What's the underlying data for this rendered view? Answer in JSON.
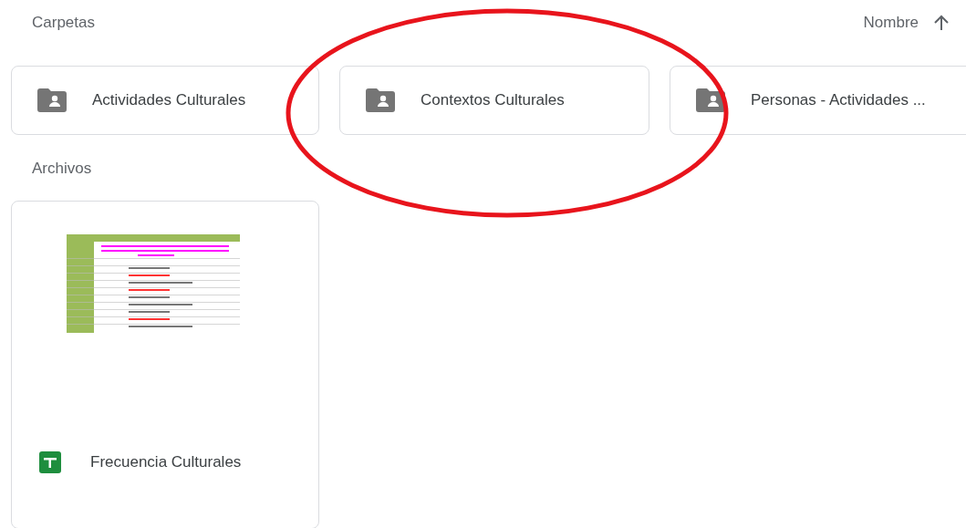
{
  "folders_section": {
    "title": "Carpetas",
    "sort": {
      "label": "Nombre",
      "ascending": true
    }
  },
  "folders": [
    {
      "name": "Actividades Culturales"
    },
    {
      "name": "Contextos Culturales"
    },
    {
      "name": "Personas - Actividades ..."
    }
  ],
  "files_section": {
    "title": "Archivos"
  },
  "files": [
    {
      "name": "Frecuencia Culturales",
      "kind": "spreadsheet"
    }
  ],
  "annotation": {
    "kind": "ellipse",
    "color": "#e8141c"
  }
}
